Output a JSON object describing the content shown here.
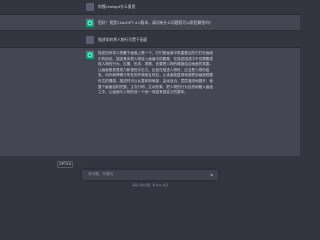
{
  "conversation": [
    {
      "role": "user",
      "text": "你懂chatgpt什么意思"
    },
    {
      "role": "assistant",
      "text": "您好！我是ChatGPT 4.0版本，请问有什么问题我可以帮您解答吗?"
    },
    {
      "role": "user",
      "text": "描述如何将人物行为置于画面"
    },
    {
      "role": "assistant",
      "text": "描述如何将人物置于画面上是一个，它们是画面中很重要且的它们在画面中的用处。描述具体把人物放入画面中的要素，在描述描述中不仅需要表现人物的行为、位置、形态、表情，还要把人物的情绪结合画面的氛围，让画面更具表现力和视觉冲击力。比如在描述人物时，应当把人物的姿态、动作和神情与所处的环境相互呼应，让读者能直观地感受到画面想要传达的情感。描述时可以从整体到局部，由远及近，层层递进地展开，使整个画面结构完整、主次分明、生动形象，把人物的行为自然地融入画面之中，让画面与人物形成一个统一而富有感染力的整体。"
    }
  ],
  "composer": {
    "regenerate_label": "GPT3.5",
    "placeholder": "有问题，尽管问",
    "footer": "请输入您的问题，按 Enter 发送"
  },
  "colors": {
    "background": "#343541",
    "assistant_row": "#444654",
    "accent": "#10a37f"
  }
}
